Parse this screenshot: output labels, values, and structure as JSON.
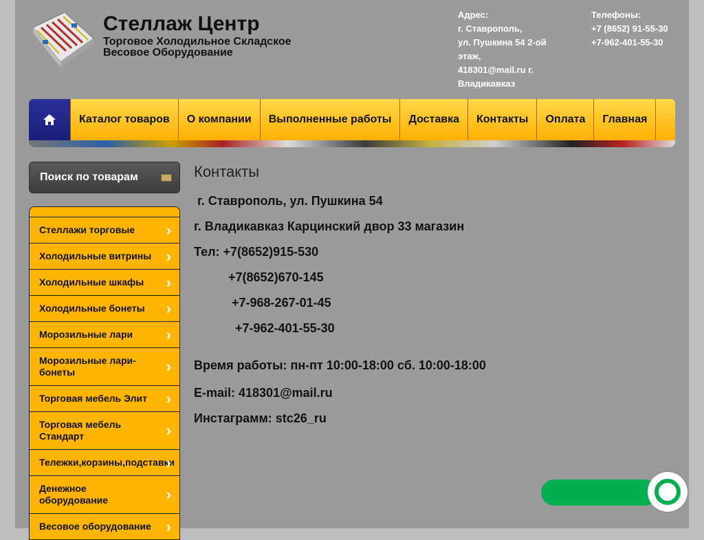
{
  "header": {
    "title": "Стеллаж Центр",
    "subtitle": "Торговое Холодильное Складское Весовое Оборудование",
    "address_label": "Адрес:",
    "address_lines": [
      "г. Ставрополь,",
      "ул. Пушкина 54 2-ой этаж,",
      "418301@mail.ru г. Владикавказ"
    ],
    "phones_label": "Телефоны:",
    "phones": [
      "+7 (8652) 91-55-30",
      "+7-962-401-55-30"
    ]
  },
  "nav": {
    "home_icon": "home-icon",
    "items": [
      "Каталог товаров",
      "О компании",
      "Выполненные работы",
      "Доставка",
      "Контакты",
      "Оплата",
      "Главная"
    ]
  },
  "sidebar": {
    "search_label": "Поиск по товарам",
    "categories": [
      "Стеллажи торговые",
      "Холодильные витрины",
      "Холодильные шкафы",
      "Холодильные бонеты",
      "Морозильные лари",
      "Морозильные лари-бонеты",
      "Торговая мебель Элит",
      "Торговая мебель Стандарт",
      "Тележки,корзины,подставки",
      "Денежное оборудование",
      "Весовое оборудование"
    ]
  },
  "content": {
    "title": "Контакты",
    "lines": [
      " г. Ставрополь, ул. Пушкина 54",
      "г. Владикавказ Карцинский двор 33 магазин",
      "Тел: +7(8652)915-530",
      "          +7(8652)670-145",
      "           +7-968-267-01-45",
      "            +7-962-401-55-30",
      "Время работы: пн-пт 10:00-18:00 сб. 10:00-18:00",
      "E-mail: 418301@mail.ru",
      "Инстаграмм: stc26_ru"
    ]
  },
  "colors": {
    "nav_yellow": "#ffc000",
    "nav_home": "#23288f",
    "chat_green": "#00b050"
  }
}
